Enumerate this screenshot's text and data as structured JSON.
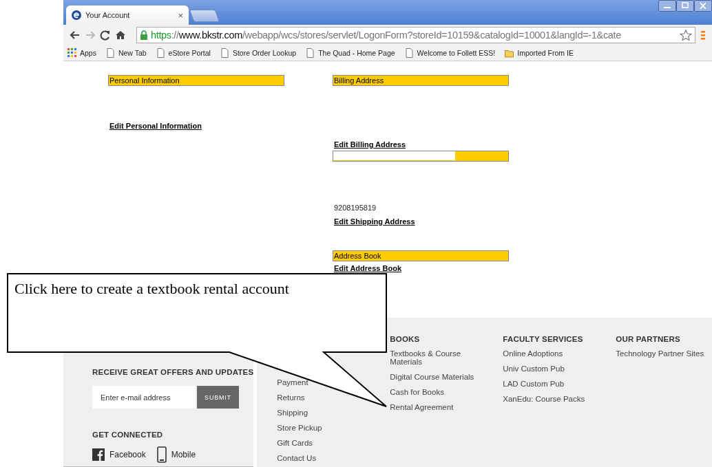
{
  "browser": {
    "tab": {
      "title": "Your Account",
      "close": "×"
    },
    "address": {
      "scheme": "https",
      "separator": "://",
      "host": "www.bkstr.com",
      "path": "/webapp/wcs/stores/servlet/LogonForm?storeId=10159&catalogId=10001&langId=-1&cate"
    },
    "bookmarks": [
      {
        "label": "Apps",
        "kind": "apps"
      },
      {
        "label": "New Tab",
        "kind": "page"
      },
      {
        "label": "eStore Portal",
        "kind": "page"
      },
      {
        "label": "Store Order Lookup",
        "kind": "page"
      },
      {
        "label": "The Quad - Home Page",
        "kind": "page"
      },
      {
        "label": "Welcome to Follett ESS!",
        "kind": "page"
      },
      {
        "label": "Imported From IE",
        "kind": "folder"
      }
    ]
  },
  "account": {
    "left": [
      {
        "kind": "header",
        "text": "Personal Information"
      },
      {
        "kind": "link",
        "text": "Edit Personal Information"
      }
    ],
    "right": [
      {
        "kind": "header",
        "text": "Billing Address"
      },
      {
        "kind": "link",
        "text": "Edit Billing Address"
      },
      {
        "kind": "covered-header"
      },
      {
        "kind": "text",
        "text": "9208195819"
      },
      {
        "kind": "link",
        "text": "Edit Shipping Address"
      },
      {
        "kind": "header",
        "text": "Address Book"
      },
      {
        "kind": "link",
        "text": "Edit Address Book"
      }
    ]
  },
  "footer": {
    "newsletter": {
      "heading": "RECEIVE GREAT OFFERS AND UPDATES",
      "placeholder": "Enter e-mail address",
      "button": "SUBMIT"
    },
    "connect": {
      "heading": "GET CONNECTED",
      "links": [
        {
          "label": "Facebook",
          "kind": "facebook"
        },
        {
          "label": "Mobile",
          "kind": "mobile"
        }
      ]
    },
    "columns": [
      {
        "links": [
          "Payment",
          "Returns",
          "Shipping",
          "Store Pickup",
          "Gift Cards",
          "Contact Us"
        ]
      },
      {
        "heading": "BOOKS",
        "links": [
          "Textbooks & Course Materials",
          "Digital Course Materials",
          "Cash for Books",
          "Rental Agreement"
        ]
      },
      {
        "heading": "FACULTY SERVICES",
        "links": [
          "Online Adoptions",
          "Univ Custom Pub",
          "LAD Custom Pub",
          "XanEdu: Course Packs"
        ]
      },
      {
        "heading": "OUR PARTNERS",
        "links": [
          "Technology Partner Sites"
        ]
      }
    ]
  },
  "callout": {
    "text": "Click here to create a textbook rental account"
  }
}
